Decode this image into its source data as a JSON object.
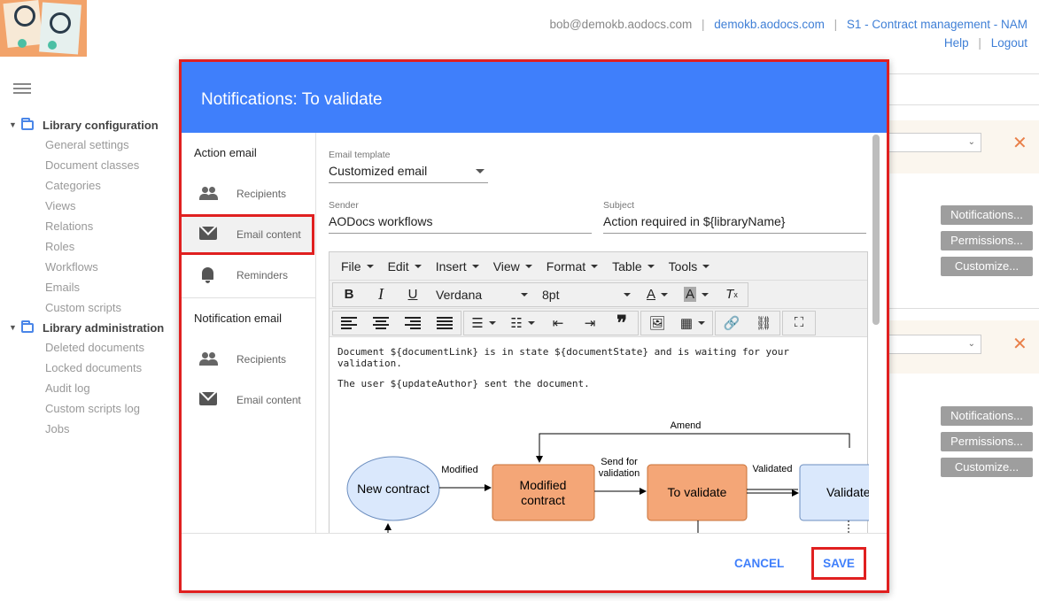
{
  "header": {
    "email": "bob@demokb.aodocs.com",
    "domain": "demokb.aodocs.com",
    "library": "S1 - Contract management - NAM",
    "help": "Help",
    "logout": "Logout",
    "separator": "|"
  },
  "sidebar": {
    "groups": [
      {
        "label": "Library configuration",
        "items": [
          "General settings",
          "Document classes",
          "Categories",
          "Views",
          "Relations",
          "Roles",
          "Workflows",
          "Emails",
          "Custom scripts"
        ]
      },
      {
        "label": "Library administration",
        "items": [
          "Deleted documents",
          "Locked documents",
          "Audit log",
          "Custom scripts log",
          "Jobs"
        ]
      }
    ]
  },
  "background_buttons": {
    "notifications": "Notifications...",
    "permissions": "Permissions...",
    "customize": "Customize..."
  },
  "modal": {
    "title": "Notifications: To validate",
    "left_nav": {
      "action_email": "Action email",
      "notification_email": "Notification email",
      "recipients": "Recipients",
      "email_content": "Email content",
      "reminders": "Reminders"
    },
    "email_template": {
      "label": "Email template",
      "value": "Customized email"
    },
    "sender": {
      "label": "Sender",
      "value": "AODocs workflows"
    },
    "subject": {
      "label": "Subject",
      "value": "Action required in ${libraryName}"
    },
    "editor": {
      "menus": [
        "File",
        "Edit",
        "Insert",
        "View",
        "Format",
        "Table",
        "Tools"
      ],
      "font": "Verdana",
      "size": "8pt",
      "body_line1": "Document ${documentLink} is in state ${documentState} and is waiting for your validation.",
      "body_line2": "The user ${updateAuthor} sent the document."
    },
    "diagram": {
      "nodes": [
        "New contract",
        "Modified contract",
        "To validate",
        "Validated"
      ],
      "edges": [
        "Modified",
        "Send for validation",
        "Validated",
        "Amend"
      ]
    },
    "footer": {
      "cancel": "CANCEL",
      "save": "SAVE"
    }
  }
}
